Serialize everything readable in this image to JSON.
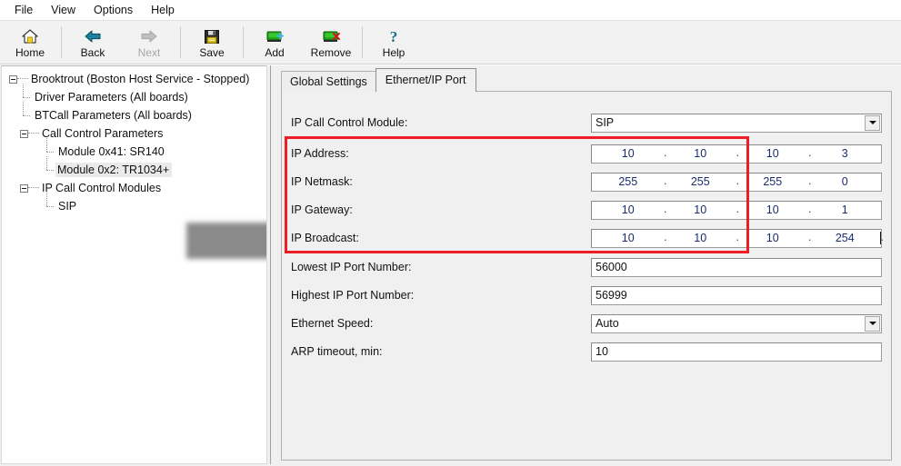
{
  "menu": {
    "items": [
      "File",
      "View",
      "Options",
      "Help"
    ]
  },
  "toolbar": {
    "buttons": [
      {
        "label": "Home",
        "icon": "home-icon",
        "disabled": false
      },
      {
        "label": "Back",
        "icon": "back-arrow-icon",
        "disabled": false
      },
      {
        "label": "Next",
        "icon": "next-arrow-icon",
        "disabled": true
      },
      {
        "label": "Save",
        "icon": "floppy-disk-icon",
        "disabled": false
      },
      {
        "label": "Add",
        "icon": "add-board-icon",
        "disabled": false
      },
      {
        "label": "Remove",
        "icon": "remove-board-icon",
        "disabled": false
      },
      {
        "label": "Help",
        "icon": "question-mark-icon",
        "disabled": false
      }
    ]
  },
  "tree": {
    "root": "Brooktrout (Boston Host Service - Stopped)",
    "nodes": [
      {
        "label": "Driver Parameters (All boards)",
        "level": 1,
        "type": "leaf"
      },
      {
        "label": "BTCall Parameters (All boards)",
        "level": 1,
        "type": "leaf"
      },
      {
        "label": "Call Control Parameters",
        "level": 1,
        "type": "expanded"
      },
      {
        "label": "Module 0x41: SR140",
        "level": 2,
        "type": "leaf"
      },
      {
        "label": "Module 0x2: TR1034+",
        "level": 2,
        "type": "leaf",
        "selected": true,
        "redacted": true
      },
      {
        "label": "IP Call Control Modules",
        "level": 1,
        "type": "expanded"
      },
      {
        "label": "SIP",
        "level": 2,
        "type": "leaf"
      }
    ]
  },
  "tabs": [
    {
      "label": "Global Settings",
      "active": false
    },
    {
      "label": "Ethernet/IP Port",
      "active": true
    }
  ],
  "form": {
    "rows": [
      {
        "id": "ip-call-control-module",
        "label": "IP Call Control Module:",
        "type": "combo",
        "value": "SIP"
      },
      {
        "id": "ip-address",
        "label": "IP Address:",
        "type": "ip",
        "octets": [
          "10",
          "10",
          "10",
          "3"
        ],
        "highlighted": true
      },
      {
        "id": "ip-netmask",
        "label": "IP Netmask:",
        "type": "ip",
        "octets": [
          "255",
          "255",
          "255",
          "0"
        ],
        "highlighted": true
      },
      {
        "id": "ip-gateway",
        "label": "IP Gateway:",
        "type": "ip",
        "octets": [
          "10",
          "10",
          "10",
          "1"
        ],
        "highlighted": true
      },
      {
        "id": "ip-broadcast",
        "label": "IP Broadcast:",
        "type": "ip",
        "octets": [
          "10",
          "10",
          "10",
          "254"
        ],
        "highlighted": true,
        "focused": true
      },
      {
        "id": "lowest-ip-port-number",
        "label": "Lowest IP Port Number:",
        "type": "text",
        "value": "56000"
      },
      {
        "id": "highest-ip-port-number",
        "label": "Highest IP Port Number:",
        "type": "text",
        "value": "56999"
      },
      {
        "id": "ethernet-speed",
        "label": "Ethernet Speed:",
        "type": "combo",
        "value": "Auto"
      },
      {
        "id": "arp-timeout",
        "label": "ARP timeout, min:",
        "type": "text",
        "value": "10"
      }
    ]
  },
  "colors": {
    "highlight_box": "#ee1c23",
    "ip_text": "#1a2b6b",
    "window_bg": "#f0f0f0",
    "panel_bg": "#ffffff"
  }
}
